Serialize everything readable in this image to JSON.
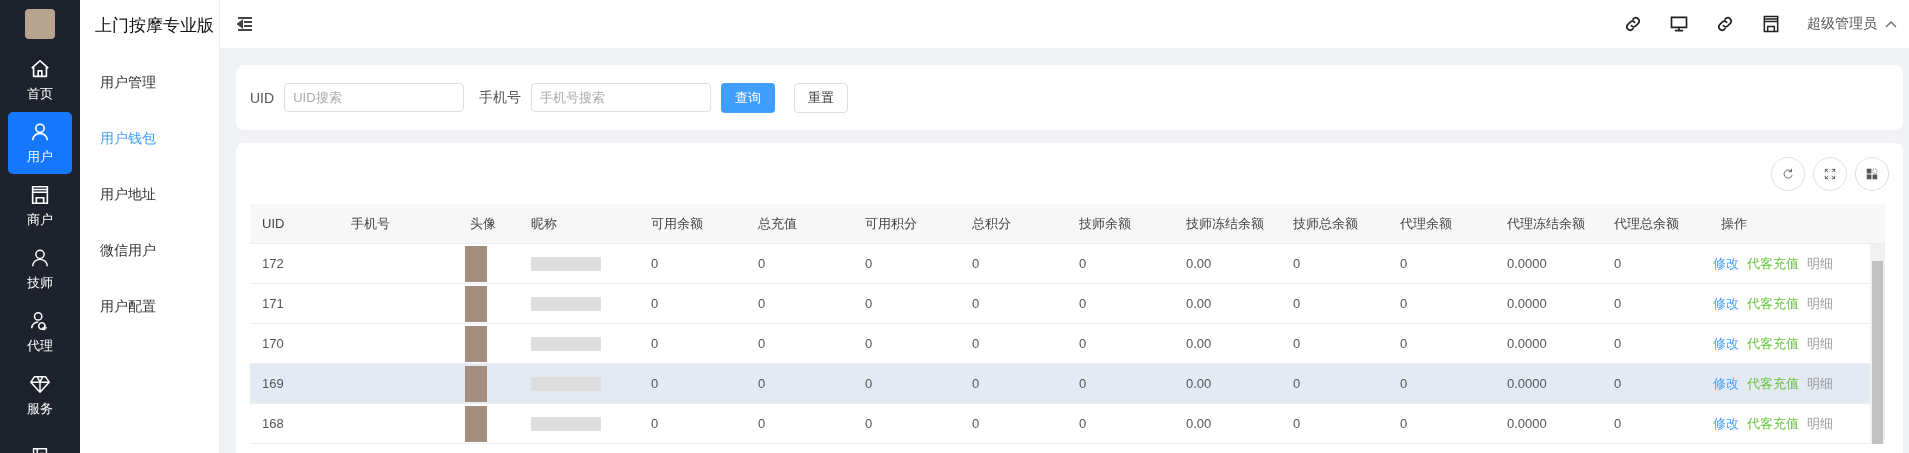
{
  "nav_items": [
    {
      "kind": "home",
      "label": "首页",
      "selected": false
    },
    {
      "kind": "user",
      "label": "用户",
      "selected": true
    },
    {
      "kind": "store",
      "label": "商户",
      "selected": false
    },
    {
      "kind": "person",
      "label": "技师",
      "selected": false
    },
    {
      "kind": "agent",
      "label": "代理",
      "selected": false
    },
    {
      "kind": "diamond",
      "label": "服务",
      "selected": false
    },
    {
      "kind": "list",
      "selected": false
    }
  ],
  "app_title": "上门按摩专业版",
  "submenu": [
    {
      "label": "用户管理",
      "selected": false
    },
    {
      "label": "用户钱包",
      "selected": true
    },
    {
      "label": "用户地址",
      "selected": false
    },
    {
      "label": "微信用户",
      "selected": false
    },
    {
      "label": "用户配置",
      "selected": false
    }
  ],
  "header": {
    "actions": [
      {
        "kind": "link"
      },
      {
        "kind": "monitor"
      },
      {
        "kind": "link"
      },
      {
        "kind": "store"
      }
    ],
    "user": "超级管理员"
  },
  "search": {
    "fields": [
      {
        "label": "UID",
        "placeholder": "UID搜索"
      },
      {
        "label": "手机号",
        "placeholder": "手机号搜索"
      }
    ],
    "buttons": [
      {
        "label": "查询",
        "kind": "primary"
      },
      {
        "label": "重置",
        "kind": "default"
      }
    ]
  },
  "table": {
    "tools": [
      {
        "kind": "refresh"
      },
      {
        "kind": "fullscreen"
      },
      {
        "kind": "grid"
      }
    ],
    "columns": [
      "UID",
      "手机号",
      "头像",
      "昵称",
      "可用余额",
      "总充值",
      "可用积分",
      "总积分",
      "技师余额",
      "技师冻结余额",
      "技师总余额",
      "代理余额",
      "代理冻结余额",
      "代理总余额",
      "操作"
    ],
    "rows": [
      {
        "uid": "172",
        "hovered": false,
        "values": [
          "0",
          "0",
          "0",
          "0",
          "0",
          "0.00",
          "0",
          "0",
          "0.0000",
          "0"
        ],
        "actions": [
          {
            "label": "修改",
            "kind": "edit"
          },
          {
            "label": "代客充值",
            "kind": "recharge"
          },
          {
            "label": "明细",
            "kind": "detail"
          }
        ]
      },
      {
        "uid": "171",
        "hovered": false,
        "values": [
          "0",
          "0",
          "0",
          "0",
          "0",
          "0.00",
          "0",
          "0",
          "0.0000",
          "0"
        ],
        "actions": [
          {
            "label": "修改",
            "kind": "edit"
          },
          {
            "label": "代客充值",
            "kind": "recharge"
          },
          {
            "label": "明细",
            "kind": "detail"
          }
        ]
      },
      {
        "uid": "170",
        "hovered": false,
        "values": [
          "0",
          "0",
          "0",
          "0",
          "0",
          "0.00",
          "0",
          "0",
          "0.0000",
          "0"
        ],
        "actions": [
          {
            "label": "修改",
            "kind": "edit"
          },
          {
            "label": "代客充值",
            "kind": "recharge"
          },
          {
            "label": "明细",
            "kind": "detail"
          }
        ]
      },
      {
        "uid": "169",
        "hovered": true,
        "values": [
          "0",
          "0",
          "0",
          "0",
          "0",
          "0.00",
          "0",
          "0",
          "0.0000",
          "0"
        ],
        "actions": [
          {
            "label": "修改",
            "kind": "edit"
          },
          {
            "label": "代客充值",
            "kind": "recharge"
          },
          {
            "label": "明细",
            "kind": "detail"
          }
        ]
      },
      {
        "uid": "168",
        "hovered": false,
        "values": [
          "0",
          "0",
          "0",
          "0",
          "0",
          "0.00",
          "0",
          "0",
          "0.0000",
          "0"
        ],
        "actions": [
          {
            "label": "修改",
            "kind": "edit"
          },
          {
            "label": "代客充值",
            "kind": "recharge"
          },
          {
            "label": "明细",
            "kind": "detail"
          }
        ]
      }
    ]
  }
}
